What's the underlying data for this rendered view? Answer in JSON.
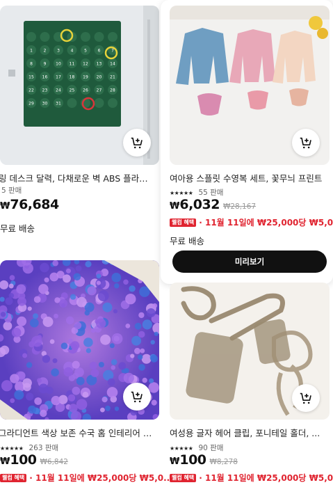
{
  "products": [
    {
      "title": "링 데스크 달력, 다채로운 벽 ABS 플라스틱",
      "sold": "5 판매",
      "currency": "₩",
      "price": "76,684",
      "shipping": "무료 배송"
    },
    {
      "title": "여아용 스플릿 수영복 세트, 꽃무늬 프린트",
      "rating_stars": "★★★★★",
      "sold": "55 판매",
      "currency": "₩",
      "price": "6,032",
      "original_price": "₩28,167",
      "promo_badge": "웰컴 혜택",
      "promo_text": "· 11월 11일에 ₩25,000당 ₩5,0...",
      "shipping": "무료 배송",
      "preview_label": "미리보기"
    },
    {
      "title": "그라디언트 색상 보존 수국 홈 인테리어 장식",
      "rating_stars": "★★★★★",
      "sold": "263 판매",
      "currency": "₩",
      "price": "100",
      "original_price": "₩6,842",
      "promo_badge": "웰컴 혜택",
      "promo_text": "· 11월 11일에 ₩25,000당 ₩5,0..."
    },
    {
      "title": "여성용 글자 헤어 클립, 포니테일 홀더, ...",
      "rating_stars": "★★★★★",
      "sold": "90 판매",
      "currency": "₩",
      "price": "100",
      "original_price": "₩8,278",
      "promo_badge": "웰컴 혜택",
      "promo_text": "· 11월 11일에 ₩25,000당 ₩5,0..."
    }
  ],
  "calendar_days": [
    "1",
    "2",
    "3",
    "4",
    "5",
    "6",
    "7",
    "8",
    "9",
    "10",
    "11",
    "12",
    "13",
    "14",
    "15",
    "16",
    "17",
    "18",
    "19",
    "20",
    "21",
    "22",
    "23",
    "24",
    "25",
    "26",
    "27",
    "28",
    "29",
    "30",
    "31"
  ],
  "icons": {
    "cart": "add-to-cart-icon"
  },
  "colors": {
    "promo_red": "#e02430",
    "preview_button": "#111111"
  }
}
